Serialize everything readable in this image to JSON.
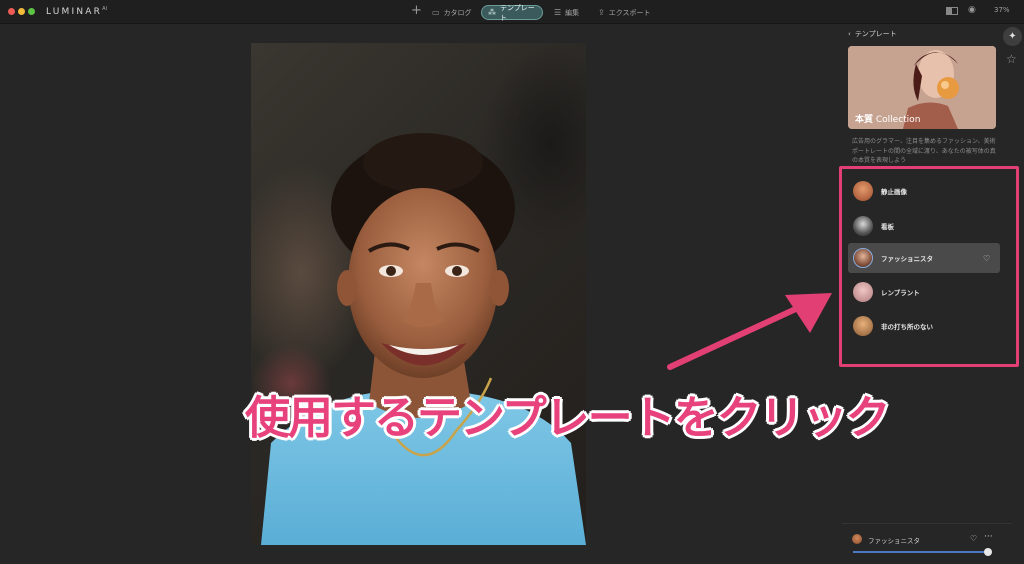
{
  "app": {
    "logo_text": "LUMINAR",
    "logo_sup": "AI"
  },
  "toolbar": {
    "add_label": "+",
    "tabs": [
      {
        "label": "カタログ",
        "icon": "folder-icon"
      },
      {
        "label": "テンプレート",
        "icon": "wand-icon",
        "active": true
      },
      {
        "label": "編集",
        "icon": "sliders-icon"
      },
      {
        "label": "エクスポート",
        "icon": "share-icon"
      }
    ],
    "zoom": "37%"
  },
  "sidebar": {
    "back_label": "テンプレート",
    "collection": {
      "title_bold": "本質",
      "title_rest": " Collection",
      "description": "広告用のグラマー、注目を集めるファッション、美術ポートレートの間の全域に渡り、あなたの被写体の真の本質を表現しよう"
    },
    "templates": [
      {
        "label": "静止画像",
        "active": false
      },
      {
        "label": "看板",
        "active": false
      },
      {
        "label": "ファッショニスタ",
        "active": true
      },
      {
        "label": "レンブラント",
        "active": false
      },
      {
        "label": "非の打ち所のない",
        "active": false
      }
    ],
    "applied": {
      "label": "ファッショニスタ",
      "amount": 1.0
    }
  },
  "overlay": {
    "caption": "使用するテンプレートをクリック"
  },
  "colors": {
    "accent_pink": "#e23f74",
    "active_tab": "#3b5a5b",
    "slider": "#4c78c4"
  }
}
